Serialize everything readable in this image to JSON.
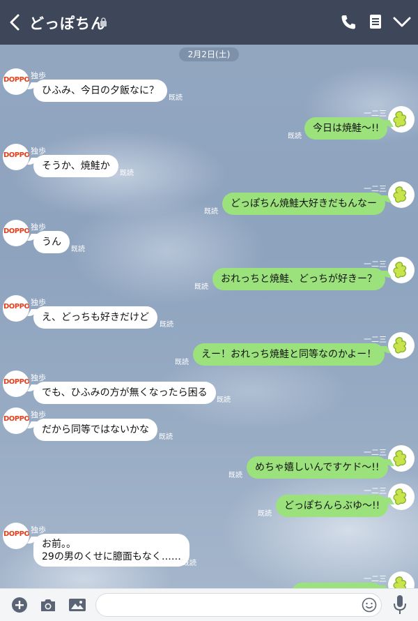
{
  "header": {
    "title": "どっぽちん"
  },
  "date_label": "2月2日(土)",
  "read_label": "既読",
  "left_name": "独歩",
  "right_name": "一二三",
  "left_avatar_text": "DOPPO",
  "messages": [
    {
      "side": "left",
      "text": "ひふみ、今日の夕飯なに？"
    },
    {
      "side": "right",
      "text": "今日は焼鮭〜!!"
    },
    {
      "side": "left",
      "text": "そうか、焼鮭か"
    },
    {
      "side": "right",
      "text": "どっぽちん焼鮭大好きだもんなー"
    },
    {
      "side": "left",
      "text": "うん"
    },
    {
      "side": "right",
      "text": "おれっちと焼鮭、どっちが好きー？"
    },
    {
      "side": "left",
      "text": "え、どっちも好きだけど"
    },
    {
      "side": "right",
      "text": "えー！おれっち焼鮭と同等なのかよー！"
    },
    {
      "side": "left",
      "text": "でも、ひふみの方が無くなったら困る"
    },
    {
      "side": "left",
      "text": "だから同等ではないかな"
    },
    {
      "side": "right",
      "text": "めちゃ嬉しいんですケド〜!!"
    },
    {
      "side": "right",
      "text": "どっぽちんらぶゆ〜!!"
    },
    {
      "side": "left",
      "text": "お前。。\n29の男のくせに臆面もなく……"
    }
  ],
  "footer": {
    "input_placeholder": ""
  },
  "colors": {
    "header_bg": "#3d4759",
    "my_bubble": "#9be27c",
    "their_bubble": "#ffffff"
  }
}
